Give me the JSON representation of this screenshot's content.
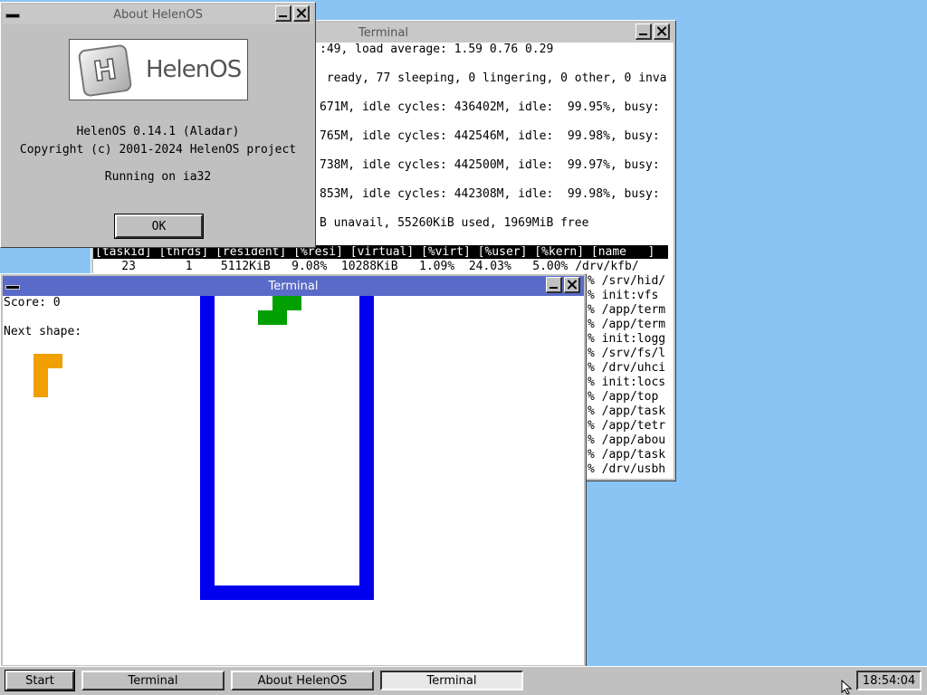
{
  "top_terminal": {
    "title": "Terminal",
    "lines": [
      ":49, load average: 1.59 0.76 0.29",
      " ready, 77 sleeping, 0 lingering, 0 other, 0 inva",
      "671M, idle cycles: 436402M, idle:  99.95%, busy:",
      "765M, idle cycles: 442546M, idle:  99.98%, busy:",
      "738M, idle cycles: 442500M, idle:  99.97%, busy:",
      "853M, idle cycles: 442308M, idle:  99.98%, busy:",
      "B unavail, 55260KiB used, 1969MiB free"
    ],
    "table_header": "[taskid] [thrds] [resident] [%resi] [virtual] [%virt] [%user] [%kern] [name   ]",
    "first_row": "    23       1    5112KiB   9.08%  10288KiB   1.09%  24.03%   5.00% /drv/kfb/",
    "row_fragments": [
      "% /srv/hid/",
      "% init:vfs",
      "% /app/term",
      "% /app/term",
      "% init:logg",
      "% /srv/fs/l",
      "% /drv/uhci",
      "% init:locs",
      "% /app/top",
      "% /app/task",
      "% /app/tetr",
      "% /app/abou",
      "% /app/task",
      "% /drv/usbh"
    ]
  },
  "about": {
    "title": "About HelenOS",
    "logo_letter": "H",
    "logo_text": "HelenOS",
    "version": "HelenOS 0.14.1 (Aladar)",
    "copyright": "Copyright (c) 2001-2024 HelenOS project",
    "running": "Running on ia32",
    "ok_label": "OK"
  },
  "tetris": {
    "title": "Terminal",
    "score_label": "Score: 0",
    "next_label": "Next shape:",
    "well_color": "#0000ee",
    "falling_color": "#00a000",
    "next_color": "#f0a000"
  },
  "taskbar": {
    "start_label": "Start",
    "buttons": [
      "Terminal",
      "About HelenOS",
      "Terminal"
    ],
    "clock": "18:54:04"
  }
}
